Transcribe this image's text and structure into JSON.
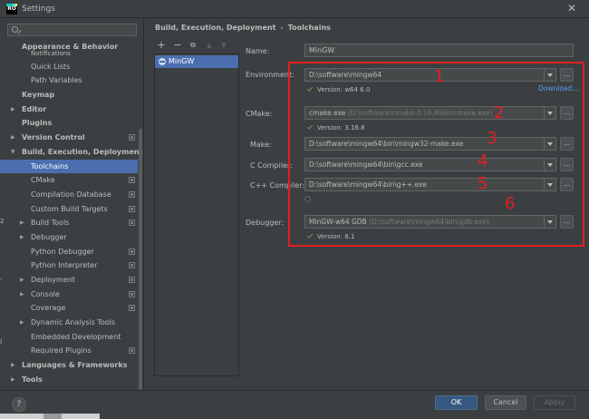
{
  "window": {
    "title": "Settings",
    "app_icon_text": "RO"
  },
  "search": {
    "placeholder": "Q–"
  },
  "tree": [
    {
      "label": "Appearance & Behavior",
      "bold": true,
      "indent": 0,
      "arrow": "",
      "gear": false
    },
    {
      "label": "Notifications",
      "bold": false,
      "indent": 2,
      "arrow": "",
      "gear": false
    },
    {
      "label": "Quick Lists",
      "bold": false,
      "indent": 2,
      "arrow": "",
      "gear": false
    },
    {
      "label": "Path Variables",
      "bold": false,
      "indent": 2,
      "arrow": "",
      "gear": false
    },
    {
      "label": "Keymap",
      "bold": true,
      "indent": 0,
      "arrow": "",
      "gear": false
    },
    {
      "label": "Editor",
      "bold": true,
      "indent": 0,
      "arrow": "right",
      "gear": false
    },
    {
      "label": "Plugins",
      "bold": true,
      "indent": 0,
      "arrow": "",
      "gear": false
    },
    {
      "label": "Version Control",
      "bold": true,
      "indent": 0,
      "arrow": "right",
      "gear": true
    },
    {
      "label": "Build, Execution, Deployment",
      "bold": true,
      "indent": 0,
      "arrow": "down",
      "gear": false
    },
    {
      "label": "Toolchains",
      "bold": false,
      "indent": 2,
      "arrow": "",
      "gear": false,
      "selected": true
    },
    {
      "label": "CMake",
      "bold": false,
      "indent": 2,
      "arrow": "",
      "gear": true
    },
    {
      "label": "Compilation Database",
      "bold": false,
      "indent": 2,
      "arrow": "",
      "gear": true
    },
    {
      "label": "Custom Build Targets",
      "bold": false,
      "indent": 2,
      "arrow": "",
      "gear": true
    },
    {
      "label": "Build Tools",
      "bold": false,
      "indent": 2,
      "arrow": "right",
      "gear": true
    },
    {
      "label": "Debugger",
      "bold": false,
      "indent": 2,
      "arrow": "right",
      "gear": false
    },
    {
      "label": "Python Debugger",
      "bold": false,
      "indent": 2,
      "arrow": "",
      "gear": true
    },
    {
      "label": "Python Interpreter",
      "bold": false,
      "indent": 2,
      "arrow": "",
      "gear": true
    },
    {
      "label": "Deployment",
      "bold": false,
      "indent": 2,
      "arrow": "right",
      "gear": true
    },
    {
      "label": "Console",
      "bold": false,
      "indent": 2,
      "arrow": "right",
      "gear": true
    },
    {
      "label": "Coverage",
      "bold": false,
      "indent": 2,
      "arrow": "",
      "gear": true
    },
    {
      "label": "Dynamic Analysis Tools",
      "bold": false,
      "indent": 2,
      "arrow": "right",
      "gear": false
    },
    {
      "label": "Embedded Development",
      "bold": false,
      "indent": 2,
      "arrow": "",
      "gear": false
    },
    {
      "label": "Required Plugins",
      "bold": false,
      "indent": 2,
      "arrow": "",
      "gear": true
    },
    {
      "label": "Languages & Frameworks",
      "bold": true,
      "indent": 0,
      "arrow": "right",
      "gear": false
    },
    {
      "label": "Tools",
      "bold": true,
      "indent": 0,
      "arrow": "right",
      "gear": false
    }
  ],
  "breadcrumb": {
    "parent": "Build, Execution, Deployment",
    "separator": "›",
    "current": "Toolchains"
  },
  "toolbar": {
    "add": "+",
    "remove": "−",
    "copy": "⧉",
    "up": "▲",
    "down": "▼"
  },
  "toolchains": [
    {
      "name": "MinGW"
    }
  ],
  "form": {
    "name_label": "Name:",
    "name_value": "MinGW",
    "environment_label": "Environment:",
    "environment_value": "D:\\software\\mingw64",
    "environment_version": "Version: w64 6.0",
    "download_link": "Download...",
    "cmake_label": "CMake:",
    "cmake_value": "cmake.exe",
    "cmake_path": "(D:\\software\\cmake-3.16.8\\bin\\cmake.exe)",
    "cmake_version": "Version: 3.16.8",
    "make_label": "Make:",
    "make_value": "D:\\software\\mingw64\\bin\\mingw32-make.exe",
    "c_compiler_label": "C Compiler:",
    "c_compiler_value": "D:\\software\\mingw64\\bin\\gcc.exe",
    "cpp_compiler_label": "C++ Compiler:",
    "cpp_compiler_value": "D:\\software\\mingw64\\bin\\g++.exe",
    "debugger_label": "Debugger:",
    "debugger_value": "MinGW-w64 GDB",
    "debugger_path": "(D:\\software\\mingw64\\bin\\gdb.exe)",
    "debugger_version": "Version: 8.1",
    "browse": "..."
  },
  "annotations": {
    "color": "#e02020",
    "numbers": [
      "1",
      "2",
      "3",
      "4",
      "5",
      "6"
    ]
  },
  "edge_fragments": [
    "2",
    "-",
    "("
  ],
  "buttons": {
    "help": "?",
    "ok": "OK",
    "cancel": "Cancel",
    "apply": "Apply"
  },
  "colors": {
    "background": "#3c3f41",
    "selection": "#4b6eaf",
    "link": "#589df6",
    "ok_button": "#365880",
    "check": "#5ca25c"
  }
}
